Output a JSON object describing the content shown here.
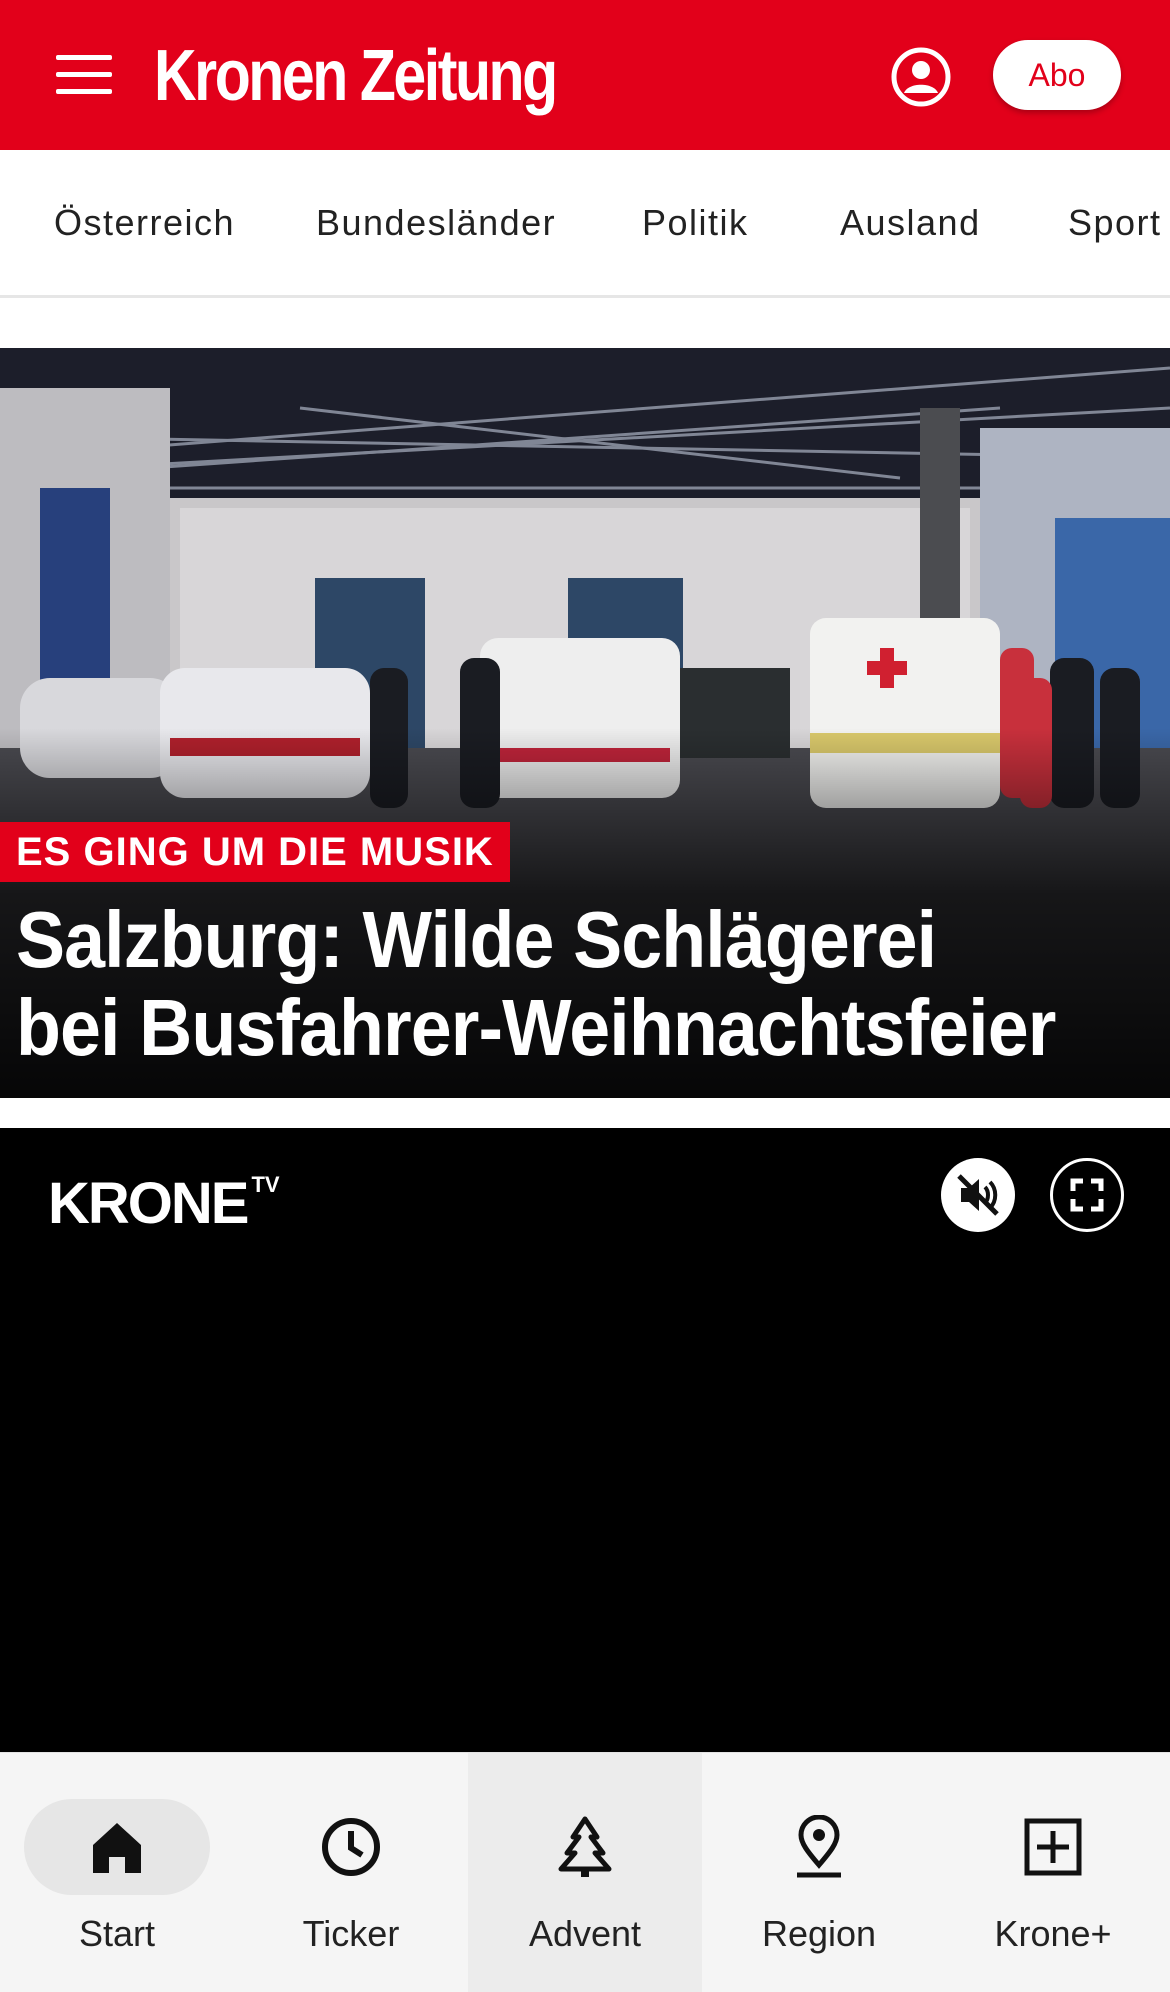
{
  "header": {
    "logo_text": "Kronen Zeitung",
    "abo_label": "Abo",
    "brand_color": "#e2001a",
    "menu_icon": "hamburger-menu-icon",
    "user_icon": "user-account-icon"
  },
  "categories": [
    {
      "label": "Österreich"
    },
    {
      "label": "Bundesländer"
    },
    {
      "label": "Politik"
    },
    {
      "label": "Ausland"
    },
    {
      "label": "Sport"
    }
  ],
  "hero": {
    "kicker": "ES GING UM DIE MUSIK",
    "headline_line1": "Salzburg: Wilde Schlägerei",
    "headline_line2": "bei Busfahrer-Weihnachtsfeier",
    "image_description": "police-and-ambulance-night-scene"
  },
  "video": {
    "logo_text": "KRONE",
    "logo_suffix": "TV",
    "mute_icon": "muted-speaker-icon",
    "fullscreen_icon": "fullscreen-icon"
  },
  "bottom_nav": [
    {
      "label": "Start",
      "icon": "home-icon",
      "active": true
    },
    {
      "label": "Ticker",
      "icon": "clock-icon",
      "active": false
    },
    {
      "label": "Advent",
      "icon": "christmas-tree-icon",
      "active": false
    },
    {
      "label": "Region",
      "icon": "location-pin-icon",
      "active": false
    },
    {
      "label": "Krone+",
      "icon": "plus-square-icon",
      "active": false
    }
  ]
}
